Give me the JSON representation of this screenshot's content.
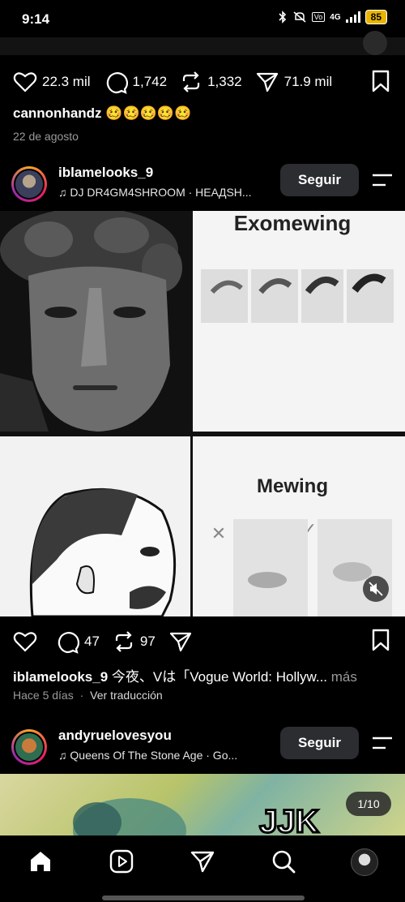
{
  "status_bar": {
    "time": "9:14",
    "network": "4G",
    "battery": "85"
  },
  "post1": {
    "likes": "22.3 mil",
    "comments": "1,742",
    "reposts": "1,332",
    "shares": "71.9 mil",
    "caption_user": "cannonhandz",
    "caption_text": "🥴🥴🥴🥴🥴",
    "date": "22 de agosto"
  },
  "post2": {
    "username": "iblamelooks_9",
    "music": "DJ DR4GM4SHROOM · HEAДSH...",
    "follow_label": "Seguir",
    "panel_top_right_title": "Exomewing",
    "panel_bottom_right_title": "Mewing",
    "likes": "",
    "comments": "47",
    "reposts": "97",
    "caption_user": "iblamelooks_9",
    "caption_text": "今夜、Vは「Vogue World: Hollyw...",
    "caption_more": "más",
    "time_ago": "Hace 5 días",
    "translate_label": "Ver traducción"
  },
  "post3": {
    "username": "andyruelovesyou",
    "music": "Queens Of The Stone Age · Go...",
    "follow_label": "Seguir",
    "page_counter": "1/10",
    "image_text": "JJK"
  },
  "nav": [
    "home-icon",
    "reels-icon",
    "send-icon",
    "search-icon",
    "profile-avatar"
  ]
}
